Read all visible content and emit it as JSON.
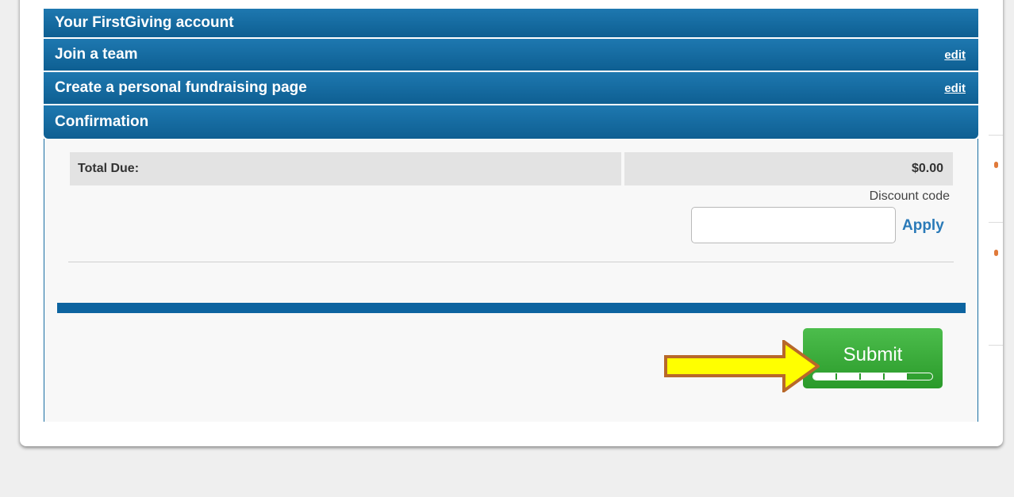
{
  "accordion": {
    "steps": [
      {
        "label": "Your FirstGiving account"
      },
      {
        "label": "Join a team",
        "edit": "edit"
      },
      {
        "label": "Create a personal fundraising page",
        "edit": "edit"
      },
      {
        "label": "Confirmation"
      }
    ]
  },
  "confirmation": {
    "total_label": "Total Due:",
    "total_value": "$0.00",
    "discount_label": "Discount code",
    "discount_value": "",
    "discount_placeholder": "",
    "apply_label": "Apply",
    "submit_label": "Submit",
    "progress_fraction": 0.8
  },
  "colors": {
    "header_blue": "#0e5f92",
    "submit_green": "#2a9a2a",
    "annotation_arrow_fill": "#ffff00",
    "annotation_arrow_border": "#b8682a"
  },
  "icons": {
    "annotation": "arrow-right-icon"
  }
}
